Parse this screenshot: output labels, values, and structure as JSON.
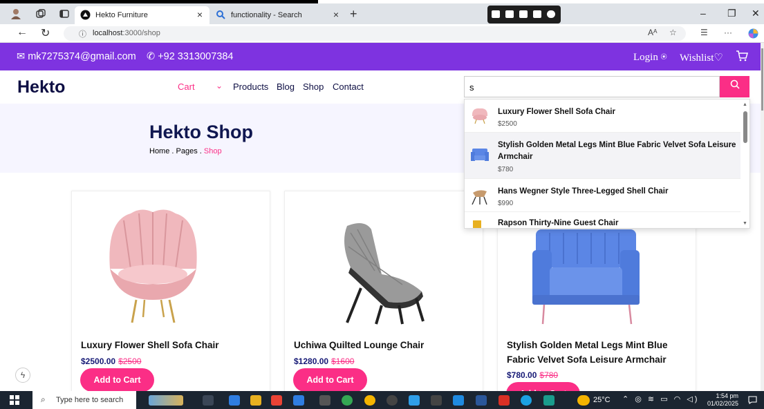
{
  "browser": {
    "tabs": [
      {
        "label": "Hekto Furniture",
        "active": true
      },
      {
        "label": "functionality - Search",
        "active": false
      }
    ],
    "url_host": "localhost",
    "url_path": ":3000/shop",
    "reader_label": "Aᴬ"
  },
  "topbar": {
    "email": "mk7275374@gmail.com",
    "phone": "+92 3313007384",
    "login": "Login",
    "wishlist": "Wishlist"
  },
  "nav": {
    "logo": "Hekto",
    "cart": "Cart",
    "links": [
      "Products",
      "Blog",
      "Shop",
      "Contact"
    ]
  },
  "search": {
    "value": "s",
    "results": [
      {
        "name": "Luxury Flower Shell Sofa Chair",
        "price": "$2500"
      },
      {
        "name": "Stylish Golden Metal Legs Mint Blue Fabric Velvet Sofa Leisure Armchair",
        "price": "$780"
      },
      {
        "name": "Hans Wegner Style Three-Legged Shell Chair",
        "price": "$990"
      },
      {
        "name": "Rapson Thirty-Nine Guest Chair",
        "price": ""
      }
    ]
  },
  "hero": {
    "title": "Hekto Shop",
    "crumb_home": "Home . Pages .",
    "crumb_current": " Shop"
  },
  "products": [
    {
      "name": "Luxury Flower Shell Sofa Chair",
      "price": "$2500.00",
      "old_price": "$2500",
      "button": "Add to Cart"
    },
    {
      "name": "Uchiwa Quilted Lounge Chair",
      "price": "$1280.00",
      "old_price": "$1600",
      "button": "Add to Cart"
    },
    {
      "name": "Stylish Golden Metal Legs Mint Blue Fabric Velvet Sofa Leisure Armchair",
      "price": "$780.00",
      "old_price": "$780",
      "button": "Add to Cart"
    }
  ],
  "taskbar": {
    "search_placeholder": "Type here to search",
    "temperature": "25°C",
    "time": "1:54 pm",
    "date": "01/02/2025"
  },
  "colors": {
    "purple": "#7e33e0",
    "pink": "#fb2e86",
    "navy": "#151875"
  }
}
